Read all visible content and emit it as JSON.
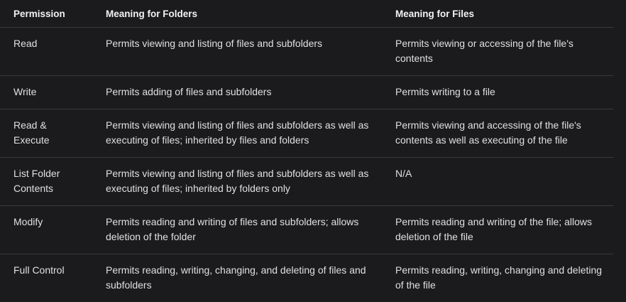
{
  "table": {
    "headers": [
      "Permission",
      "Meaning for Folders",
      "Meaning for Files"
    ],
    "rows": [
      {
        "permission": "Read",
        "folders": "Permits viewing and listing of files and subfolders",
        "files": "Permits viewing or accessing of the file's contents"
      },
      {
        "permission": "Write",
        "folders": "Permits adding of files and subfolders",
        "files": "Permits writing to a file"
      },
      {
        "permission": "Read & Execute",
        "folders": "Permits viewing and listing of files and subfolders as well as executing of files; inherited by files and folders",
        "files": "Permits viewing and accessing of the file's contents as well as executing of the file"
      },
      {
        "permission": "List Folder Contents",
        "folders": "Permits viewing and listing of files and subfolders as well as executing of files; inherited by folders only",
        "files": "N/A"
      },
      {
        "permission": "Modify",
        "folders": "Permits reading and writing of files and subfolders; allows deletion of the folder",
        "files": "Permits reading and writing of the file; allows deletion of the file"
      },
      {
        "permission": "Full Control",
        "folders": "Permits reading, writing, changing, and deleting of files and subfolders",
        "files": "Permits reading, writing, changing and deleting of the file"
      }
    ]
  }
}
